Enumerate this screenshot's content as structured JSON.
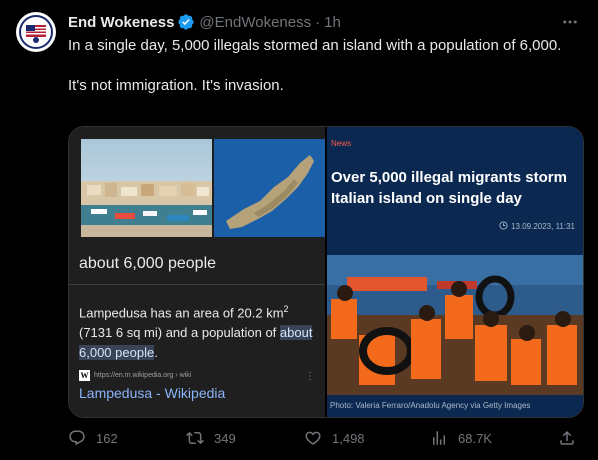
{
  "author": {
    "display_name": "End Wokeness",
    "handle": "@EndWokeness",
    "separator": "·",
    "time": "1h"
  },
  "tweet": {
    "line1": "In a single day, 5,000 illegals stormed an island with a population of 6,000.",
    "line2": "It's not immigration. It's invasion."
  },
  "left_card": {
    "population_title": "about 6,000 people",
    "desc_prefix": "Lampedusa has an area of 20.2 km",
    "desc_sup": "2",
    "desc_mid": " (7131 6 sq mi) and a population of ",
    "desc_highlight": "about 6,000 people",
    "desc_suffix": ".",
    "source_url": "https://en.m.wikipedia.org › wiki",
    "wiki_badge": "W",
    "link_text": "Lampedusa - Wikipedia"
  },
  "right_card": {
    "tag": "News",
    "headline": "Over 5,000 illegal migrants storm Italian island on single day",
    "date": "13.09.2023, 11:31",
    "photo_credit": "Photo: Valeria Ferraro/Anadolu Agency via Getty Images"
  },
  "actions": {
    "replies": "162",
    "reposts": "349",
    "likes": "1,498",
    "views": "68.7K"
  },
  "colors": {
    "verified": "#1d9bf0",
    "link": "#8ab4f8",
    "news_tag": "#ff5a4a",
    "news_bg": "#0b2950"
  }
}
